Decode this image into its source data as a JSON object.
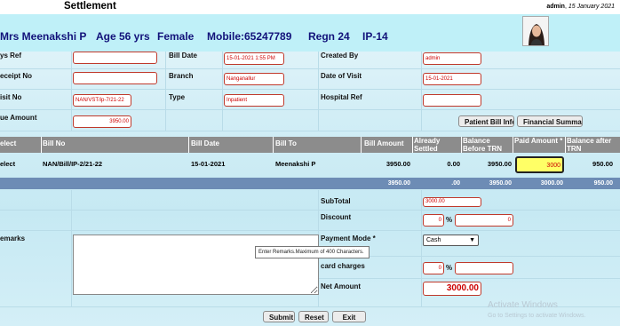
{
  "header": {
    "page_title": "Settlement",
    "user": "admin",
    "date": "15 January 2021"
  },
  "patient": {
    "name": "Mrs Meenakshi P",
    "age": "Age 56 yrs",
    "gender": "Female",
    "mobile": "Mobile:65247789",
    "regn": "Regn 24",
    "ip": "IP-14"
  },
  "form": {
    "sys_ref_label": "ys Ref",
    "sys_ref_value": "",
    "bill_date_label": "Bill Date",
    "bill_date_value": "15-01-2021 1:55 PM",
    "created_by_label": "Created By",
    "created_by_value": "admin",
    "receipt_no_label": "eceipt No",
    "receipt_no_value": "",
    "branch_label": "Branch",
    "branch_value": "Nanganallur",
    "date_of_visit_label": "Date of Visit",
    "date_of_visit_value": "15-01-2021",
    "visit_no_label": "isit No",
    "visit_no_value": "NAN/VST/ip-7/21-22",
    "type_label": "Type",
    "type_value": "Inpatient",
    "hospital_ref_label": "Hospital Ref",
    "hospital_ref_value": "",
    "due_amount_label": "ue Amount",
    "due_amount_value": "3950.00",
    "patient_bill_info_btn": "Patient Bill Info",
    "financial_summary_btn": "Financial Summary"
  },
  "table": {
    "headers": {
      "select": "elect",
      "bill_no": "Bill No",
      "bill_date": "Bill Date",
      "bill_to": "Bill To",
      "bill_amount": "Bill Amount",
      "already_settled": "Already Settled",
      "balance_before": "Balance Before TRN",
      "paid_amount": "Paid Amount *",
      "balance_after": "Balance after TRN"
    },
    "row": {
      "select": "elect",
      "bill_no": "NAN/Bill/IP-2/21-22",
      "bill_date": "15-01-2021",
      "bill_to": "Meenakshi P",
      "bill_amount": "3950.00",
      "already_settled": "0.00",
      "balance_before": "3950.00",
      "paid_amount": "3000",
      "balance_after": "950.00"
    },
    "totals": {
      "bill_amount": "3950.00",
      "already_settled": ".00",
      "balance_before": "3950.00",
      "paid_amount": "3000.00",
      "balance_after": "950.00"
    }
  },
  "summary": {
    "subtotal_label": "SubTotal",
    "subtotal_value": "3000.00",
    "discount_label": "Discount",
    "discount_pct": "0",
    "discount_amt": "0",
    "percent_symbol": "%",
    "remarks_label": "emarks",
    "remarks_value": "",
    "remarks_tooltip": "Enter Remarks.Maximum of 400 Characters.",
    "payment_mode_label": "Payment Mode *",
    "payment_mode_value": "Cash",
    "card_charges_label": "card charges",
    "card_charges_pct": "0",
    "card_charges_amt": "",
    "net_amount_label": "Net Amount",
    "net_amount_value": "3000.00"
  },
  "buttons": {
    "submit": "Submit",
    "reset": "Reset",
    "exit": "Exit"
  },
  "watermark": {
    "title": "Activate Windows",
    "subtitle": "Go to Settings to activate Windows."
  }
}
